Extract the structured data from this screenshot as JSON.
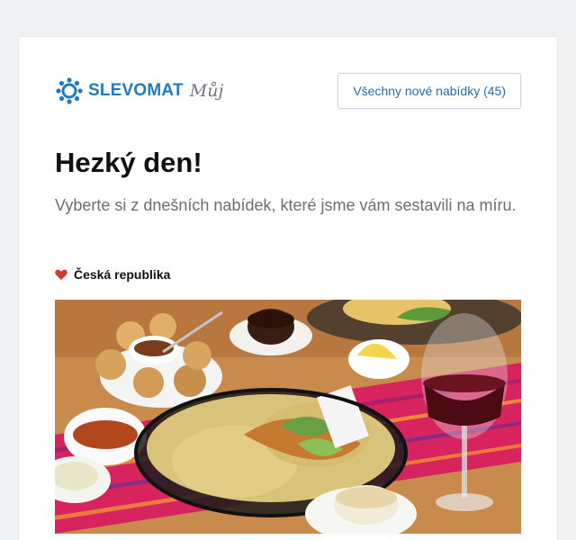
{
  "brand": {
    "name": "SLEVOMAT",
    "sub": "Můj",
    "logo_icon": "gear-icon",
    "color": "#1f7bc0"
  },
  "header": {
    "all_offers_label": "Všechny nové nabídky (45)"
  },
  "greeting": {
    "title": "Hezký den!",
    "subtitle": "Vyberte si z dnešních nabídek, které jsme vám sestavili na míru."
  },
  "section": {
    "icon": "heart-icon",
    "label": "Česká republika",
    "icon_color": "#d23a2e"
  },
  "deal": {
    "image_subject": "food-photo"
  }
}
